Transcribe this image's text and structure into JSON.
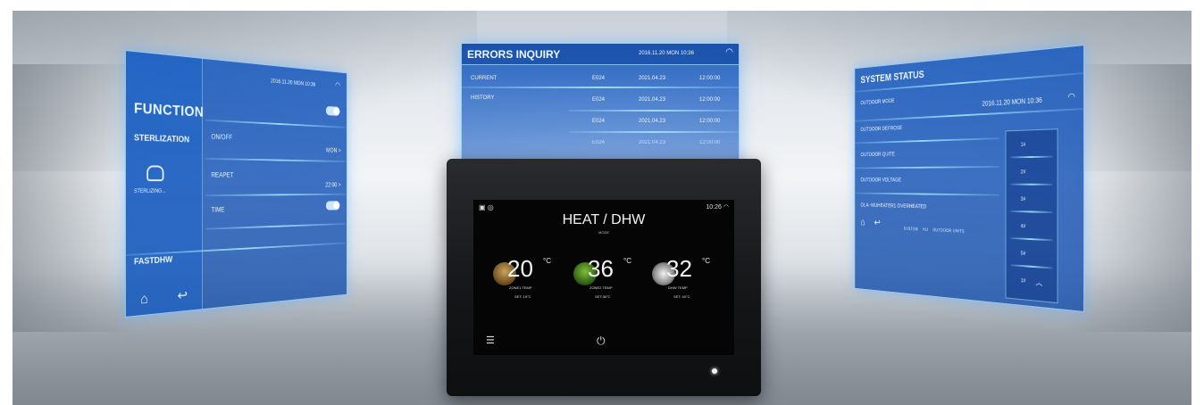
{
  "function_panel": {
    "title": "FUNCTION",
    "date": "2016.11.20",
    "day": "MON",
    "time": "10:36",
    "menu": [
      "STERLIZATION",
      "FASTDHW"
    ],
    "sterilizing_label": "STERLIZING...",
    "rows": [
      {
        "label": "ON/OFF",
        "value": ""
      },
      {
        "label": "REAPET",
        "value": "MON >"
      },
      {
        "label": "TIME",
        "value": "22:00 >"
      }
    ],
    "icons": [
      "wifi-icon",
      "home-icon",
      "back-icon",
      "sterilize-icon"
    ]
  },
  "errors_panel": {
    "title": "ERRORS INQUIRY",
    "date": "2016.11.20",
    "day": "MON",
    "time": "10:36",
    "tabs": [
      "CURRENT",
      "HISTORY"
    ],
    "rows": [
      {
        "code": "E024",
        "date": "2021.04.23",
        "time": "12:00:00"
      },
      {
        "code": "E024",
        "date": "2021.04.23",
        "time": "12:00:00"
      },
      {
        "code": "E024",
        "date": "2021.04.23",
        "time": "12:00:00"
      },
      {
        "code": "E024",
        "date": "2021.04.23",
        "time": "12:00:00"
      }
    ]
  },
  "system_panel": {
    "title": "SYSTEM STATUS",
    "date": "2016.11.20",
    "day": "MON",
    "time": "10:36",
    "rows": [
      "OUTDOOR MODE",
      "OUTDOOR DEFROSE",
      "OUTDOOR QUITE",
      "OUTDOOR VOLTAGE",
      "OLA--MUHEATER1 OVERHEATED"
    ],
    "units": [
      "1#",
      "2#",
      "3#",
      "4#",
      "5#",
      "1#"
    ],
    "tabs": [
      "SYSTEM",
      "HU",
      "OUTDOOR UNITS"
    ]
  },
  "device_screen": {
    "time": "10:26",
    "mode": "HEAT / DHW",
    "mode_label": "MODE",
    "zones": [
      {
        "temp": "20",
        "unit": "°C",
        "label": "ZONE1 TEMP",
        "set": "SET: 19°C"
      },
      {
        "temp": "36",
        "unit": "°C",
        "label": "ZONE2 TEMP",
        "set": "SET:36°C"
      },
      {
        "temp": "32",
        "unit": "°C",
        "label": "DHW TEMP",
        "set": "SET: 40°C"
      }
    ]
  },
  "colors": {
    "panel_blue": "#1a5ac0",
    "panel_line": "#9fdcff",
    "device_black": "#141517"
  }
}
